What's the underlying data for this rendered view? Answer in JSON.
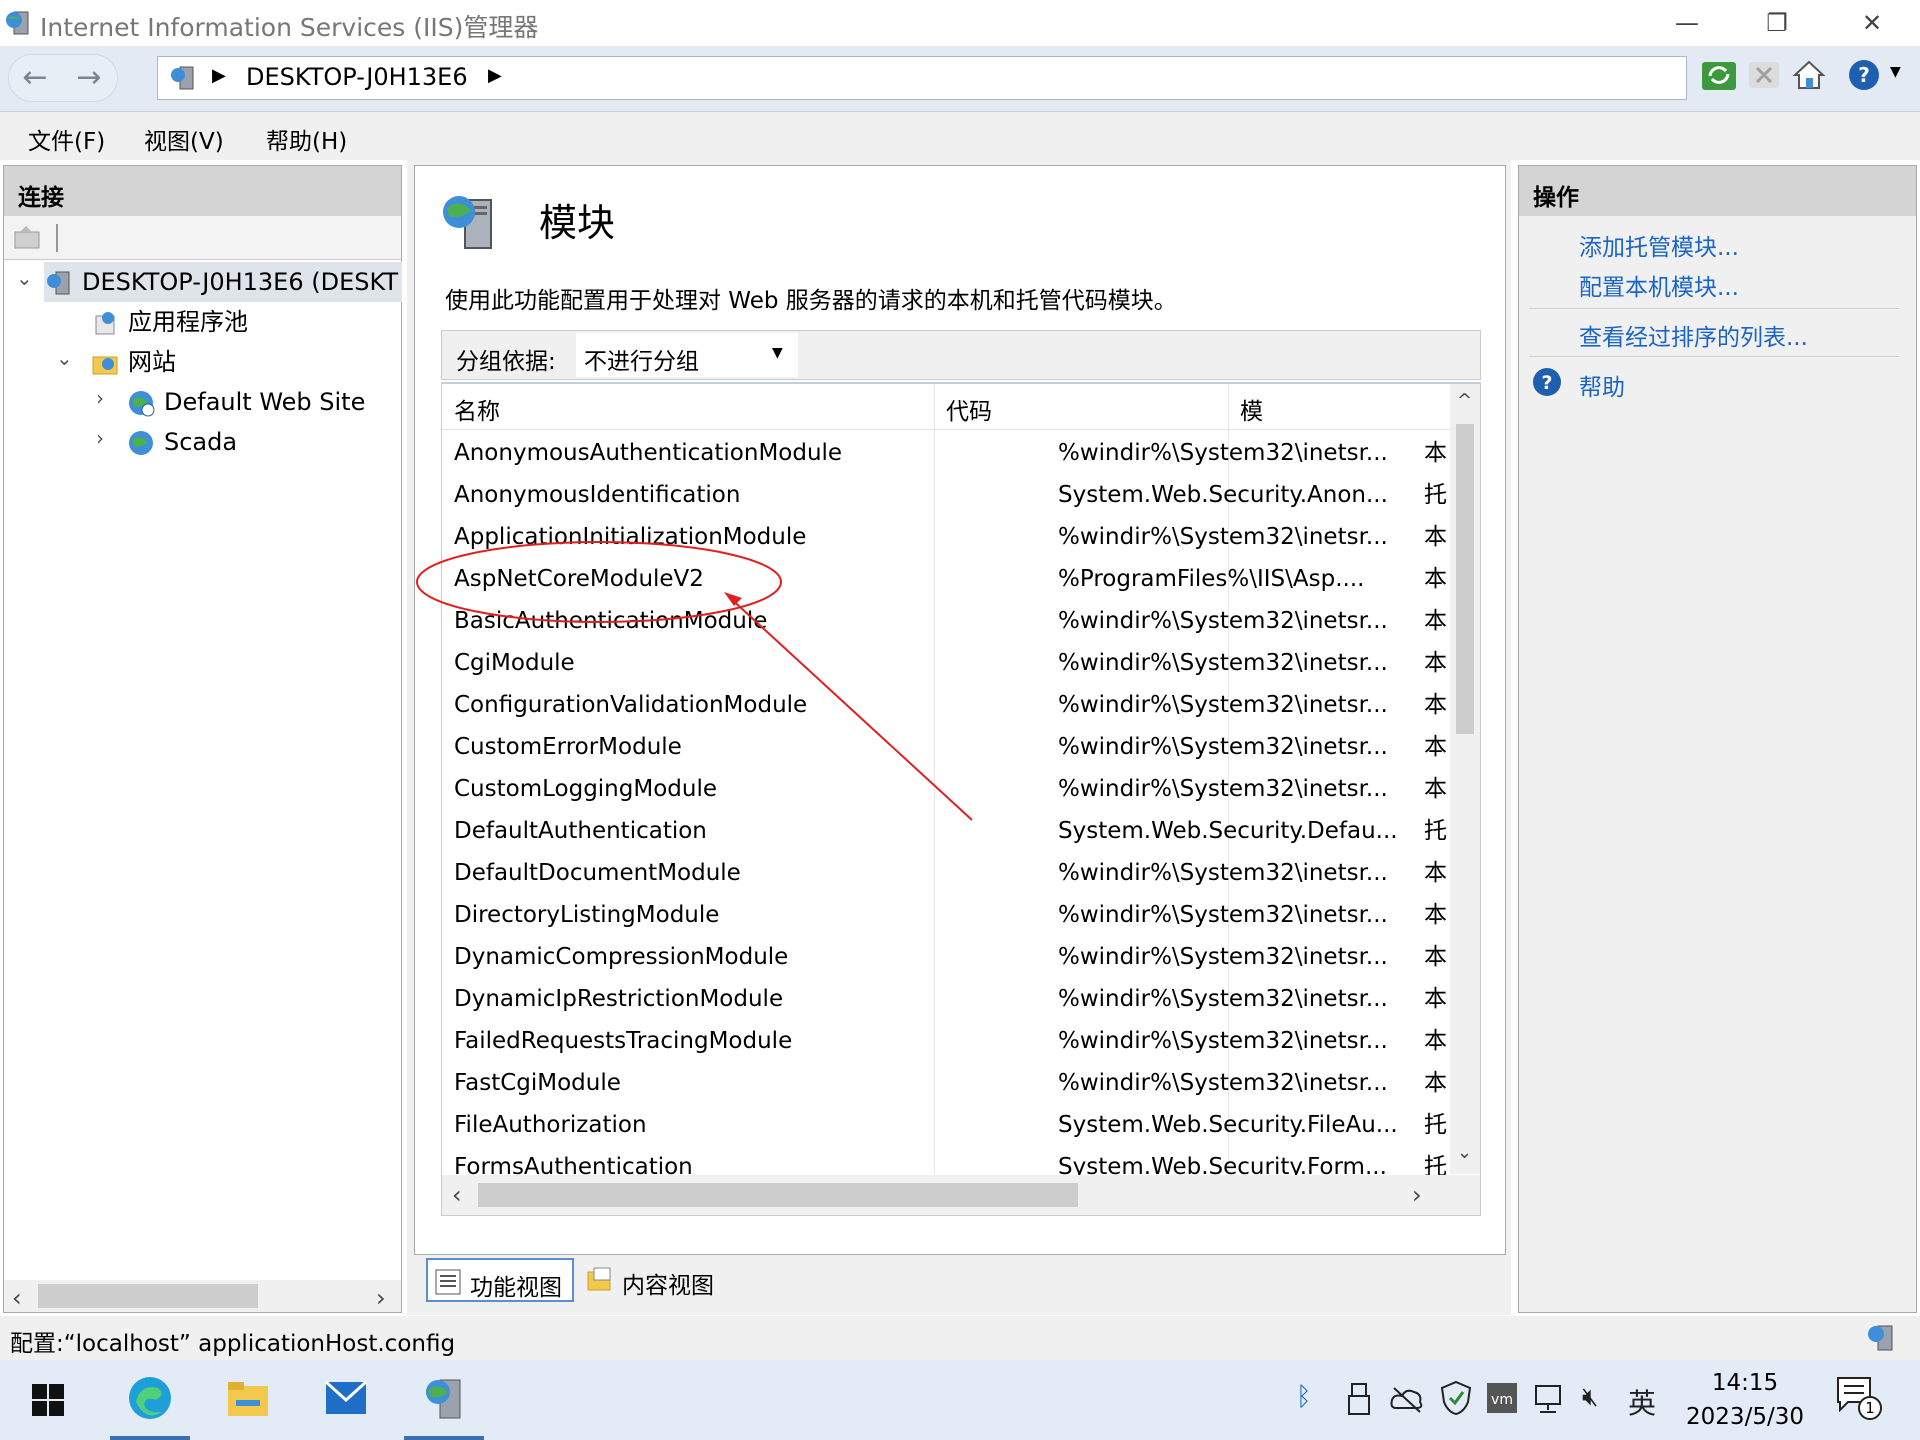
{
  "window": {
    "title": "Internet Information Services (IIS)管理器",
    "minimize": "—",
    "restore": "❐",
    "close": "✕"
  },
  "address": {
    "back": "←",
    "forward": "→",
    "arrow": "▶",
    "crumb": "DESKTOP-J0H13E6"
  },
  "menu": {
    "file": "文件(F)",
    "view": "视图(V)",
    "help": "帮助(H)"
  },
  "connections": {
    "header": "连接",
    "tree": [
      {
        "label": "DESKTOP-J0H13E6 (DESKT",
        "chevron": "⌄"
      },
      {
        "label": "应用程序池",
        "chevron": ""
      },
      {
        "label": "网站",
        "chevron": "⌄"
      },
      {
        "label": "Default Web Site",
        "chevron": "›"
      },
      {
        "label": "Scada",
        "chevron": "›"
      }
    ],
    "scroll_left": "‹",
    "scroll_right": "›"
  },
  "main": {
    "title": "模块",
    "description": "使用此功能配置用于处理对 Web 服务器的请求的本机和托管代码模块。",
    "group_label": "分组依据:",
    "group_value": "不进行分组",
    "group_caret": "▼",
    "columns": {
      "name": "名称",
      "code": "代码",
      "type": "模"
    },
    "sort_indicator": "^",
    "rows": [
      {
        "name": "AnonymousAuthenticationModule",
        "code": "%windir%\\System32\\inetsr...",
        "type": "本"
      },
      {
        "name": "AnonymousIdentification",
        "code": "System.Web.Security.Anon...",
        "type": "托"
      },
      {
        "name": "ApplicationInitializationModule",
        "code": "%windir%\\System32\\inetsr...",
        "type": "本"
      },
      {
        "name": "AspNetCoreModuleV2",
        "code": "%ProgramFiles%\\IIS\\Asp....",
        "type": "本"
      },
      {
        "name": "BasicAuthenticationModule",
        "code": "%windir%\\System32\\inetsr...",
        "type": "本"
      },
      {
        "name": "CgiModule",
        "code": "%windir%\\System32\\inetsr...",
        "type": "本"
      },
      {
        "name": "ConfigurationValidationModule",
        "code": "%windir%\\System32\\inetsr...",
        "type": "本"
      },
      {
        "name": "CustomErrorModule",
        "code": "%windir%\\System32\\inetsr...",
        "type": "本"
      },
      {
        "name": "CustomLoggingModule",
        "code": "%windir%\\System32\\inetsr...",
        "type": "本"
      },
      {
        "name": "DefaultAuthentication",
        "code": "System.Web.Security.Defau...",
        "type": "托"
      },
      {
        "name": "DefaultDocumentModule",
        "code": "%windir%\\System32\\inetsr...",
        "type": "本"
      },
      {
        "name": "DirectoryListingModule",
        "code": "%windir%\\System32\\inetsr...",
        "type": "本"
      },
      {
        "name": "DynamicCompressionModule",
        "code": "%windir%\\System32\\inetsr...",
        "type": "本"
      },
      {
        "name": "DynamicIpRestrictionModule",
        "code": "%windir%\\System32\\inetsr...",
        "type": "本"
      },
      {
        "name": "FailedRequestsTracingModule",
        "code": "%windir%\\System32\\inetsr...",
        "type": "本"
      },
      {
        "name": "FastCgiModule",
        "code": "%windir%\\System32\\inetsr...",
        "type": "本"
      },
      {
        "name": "FileAuthorization",
        "code": "System.Web.Security.FileAu...",
        "type": "托"
      },
      {
        "name": "FormsAuthentication",
        "code": "System.Web.Security.Form...",
        "type": "托"
      }
    ],
    "scroll_up": "^",
    "scroll_down": "⌄",
    "scroll_left": "‹",
    "scroll_right": "›",
    "tabs": {
      "features": "功能视图",
      "content": "内容视图"
    }
  },
  "actions": {
    "header": "操作",
    "add_managed": "添加托管模块...",
    "config_native": "配置本机模块...",
    "view_ordered": "查看经过排序的列表...",
    "help": "帮助"
  },
  "status": {
    "text": "配置:“localhost” applicationHost.config"
  },
  "taskbar": {
    "ime": "英",
    "time": "14:15",
    "date": "2023/5/30",
    "notifications": "1"
  },
  "colors": {
    "accent": "#1a64c8",
    "annotation": "#e02020"
  }
}
